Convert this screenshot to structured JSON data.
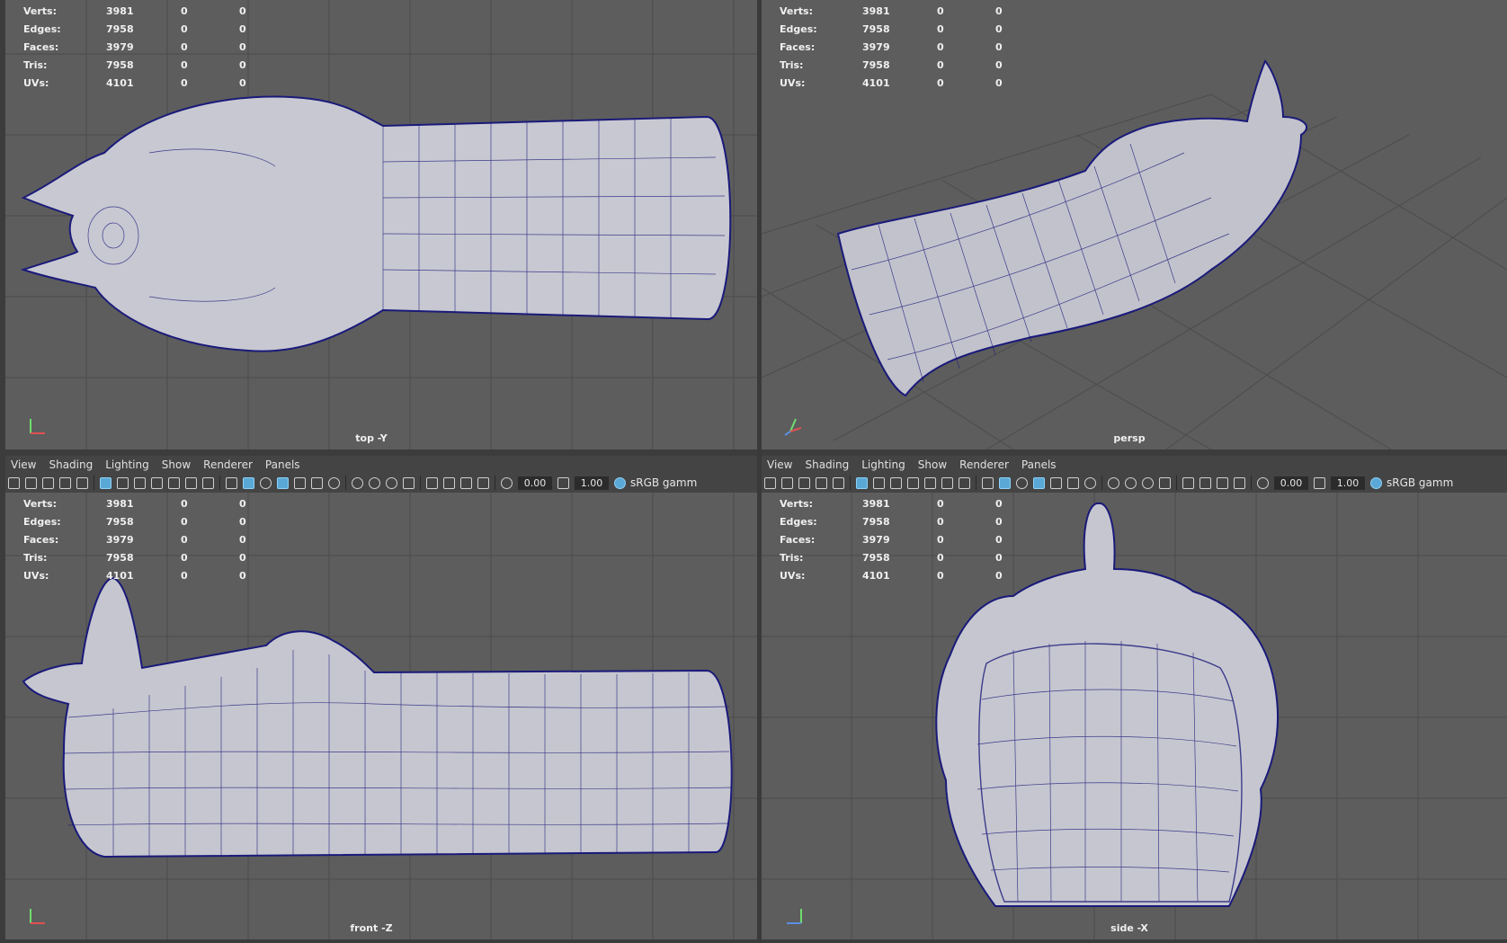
{
  "stats": {
    "rows": [
      {
        "label": "Verts:",
        "value": "3981",
        "a": "0",
        "b": "0"
      },
      {
        "label": "Edges:",
        "value": "7958",
        "a": "0",
        "b": "0"
      },
      {
        "label": "Faces:",
        "value": "3979",
        "a": "0",
        "b": "0"
      },
      {
        "label": "Tris:",
        "value": "7958",
        "a": "0",
        "b": "0"
      },
      {
        "label": "UVs:",
        "value": "4101",
        "a": "0",
        "b": "0"
      }
    ]
  },
  "viewports": {
    "top": {
      "camera": "top -Y"
    },
    "persp": {
      "camera": "persp"
    },
    "front": {
      "camera": "front -Z"
    },
    "side": {
      "camera": "side -X"
    }
  },
  "panel_menu": {
    "items": [
      "View",
      "Shading",
      "Lighting",
      "Show",
      "Renderer",
      "Panels"
    ]
  },
  "panel_toolbar": {
    "exposure": "0.00",
    "gamma": "1.00",
    "color_space": "sRGB gamm"
  },
  "colors": {
    "viewport_bg": "#5d5d5d",
    "grid": "#4c4c4c",
    "mesh_wire": "#1a1a7a",
    "mesh_fill": "#c8c8d2",
    "accent": "#5aa8d6"
  }
}
